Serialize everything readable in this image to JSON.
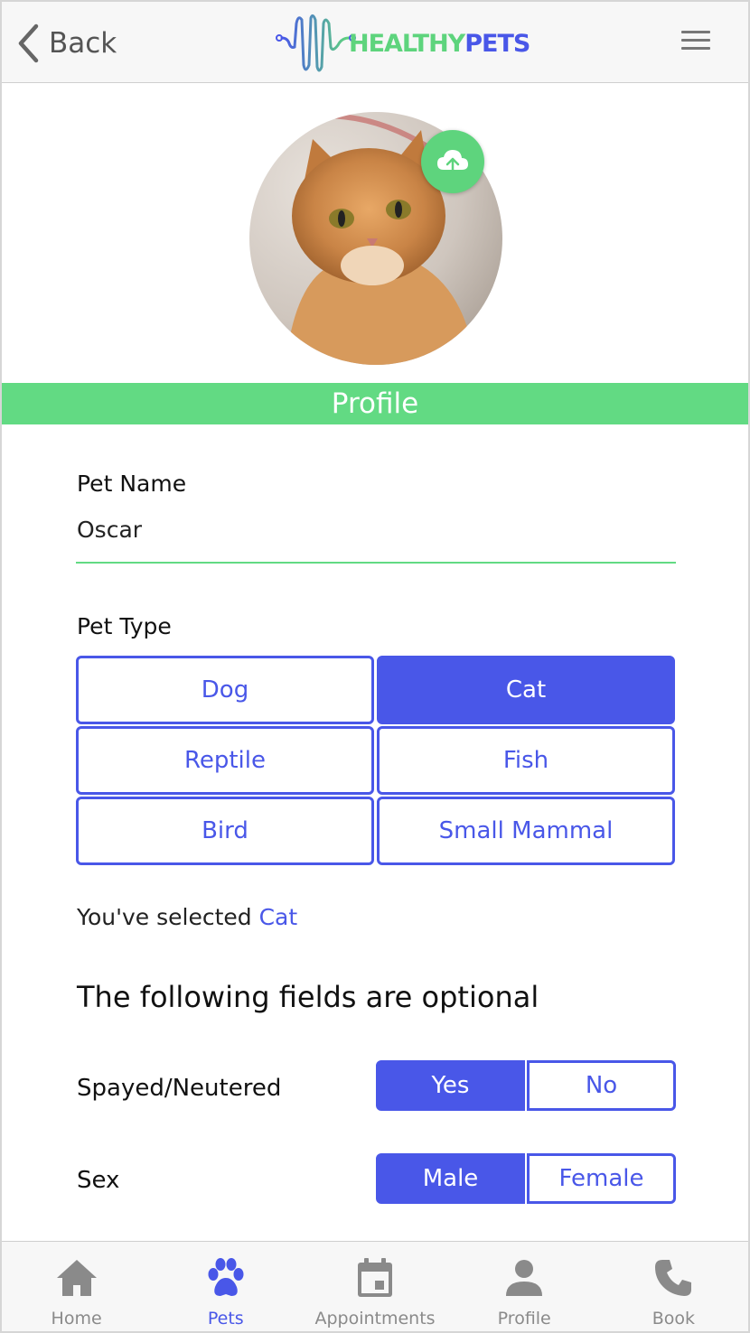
{
  "header": {
    "back_label": "Back",
    "logo_left": "HEALTHY",
    "logo_right": "PETS",
    "menu_icon": "hamburger-menu-icon"
  },
  "avatar": {
    "image": "orange tabby cat photo",
    "upload_icon": "cloud-upload-icon"
  },
  "section_title": "Profile",
  "form": {
    "pet_name_label": "Pet Name",
    "pet_name_value": "Oscar",
    "pet_type_label": "Pet Type",
    "pet_types": [
      {
        "label": "Dog",
        "selected": false
      },
      {
        "label": "Cat",
        "selected": true
      },
      {
        "label": "Reptile",
        "selected": false
      },
      {
        "label": "Fish",
        "selected": false
      },
      {
        "label": "Bird",
        "selected": false
      },
      {
        "label": "Small Mammal",
        "selected": false
      }
    ],
    "selected_prefix": "You've selected",
    "selected_value": "Cat",
    "optional_heading": "The following fields are optional",
    "spayed_label": "Spayed/Neutered",
    "spayed_options": [
      "Yes",
      "No"
    ],
    "spayed_selected": "Yes",
    "sex_label": "Sex",
    "sex_options": [
      "Male",
      "Female"
    ],
    "sex_selected": "Male"
  },
  "tabbar": [
    {
      "label": "Home",
      "icon": "home-icon",
      "active": false
    },
    {
      "label": "Pets",
      "icon": "paw-icon",
      "active": true
    },
    {
      "label": "Appointments",
      "icon": "calendar-icon",
      "active": false
    },
    {
      "label": "Profile",
      "icon": "person-icon",
      "active": false
    },
    {
      "label": "Book",
      "icon": "phone-icon",
      "active": false
    }
  ],
  "colors": {
    "brand_green": "#62da83",
    "brand_blue": "#4957e8",
    "tab_inactive": "#8a8a8a"
  }
}
